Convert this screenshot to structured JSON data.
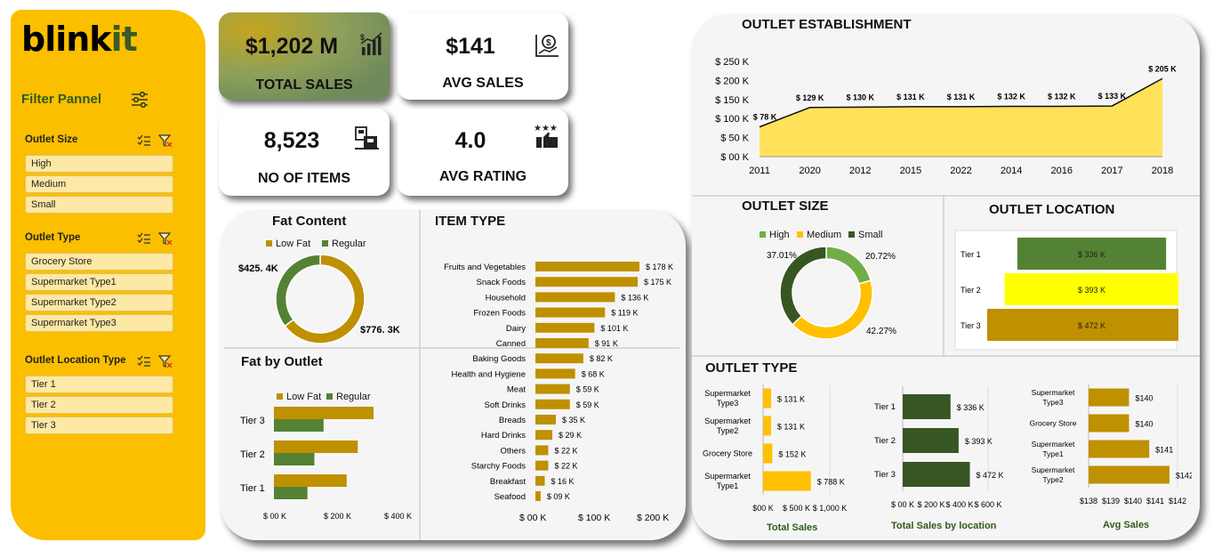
{
  "sidebar": {
    "logo_main": "blink",
    "logo_accent": "it",
    "filter_title": "Filter Pannel",
    "groups": [
      {
        "title": "Outlet Size",
        "items": [
          "High",
          "Medium",
          "Small"
        ]
      },
      {
        "title": "Outlet Type",
        "items": [
          "Grocery Store",
          "Supermarket Type1",
          "Supermarket Type2",
          "Supermarket Type3"
        ]
      },
      {
        "title": "Outlet Location Type",
        "items": [
          "Tier 1",
          "Tier 2",
          "Tier 3"
        ]
      }
    ]
  },
  "kpis": {
    "total_sales": {
      "value": "$1,202 M",
      "label": "TOTAL SALES",
      "icon": "bar-chart-money-icon"
    },
    "avg_sales": {
      "value": "$141",
      "label": "AVG SALES",
      "icon": "money-chart-icon"
    },
    "no_of_items": {
      "value": "8,523",
      "label": "NO OF ITEMS",
      "icon": "shopping-items-icon"
    },
    "avg_rating": {
      "value": "4.0",
      "label": "AVG RATING",
      "icon": "thumbs-up-stars-icon"
    }
  },
  "colors": {
    "gold": "#bf9000",
    "green": "#548235",
    "dark_green": "#375623",
    "yellow": "#ffff00",
    "bright_gold": "#ffc000",
    "area_fill": "#ffe699",
    "sidebar": "#fbbf00"
  },
  "chart_data": [
    {
      "id": "fat_content",
      "type": "pie",
      "title": "Fat Content",
      "legend": "top",
      "categories": [
        "Low Fat",
        "Regular"
      ],
      "values": [
        776.3,
        425.4
      ],
      "labels": [
        "$776. 3K",
        "$425. 4K"
      ]
    },
    {
      "id": "fat_by_outlet",
      "type": "bar",
      "title": "Fat by Outlet",
      "orientation": "horizontal",
      "legend": "top",
      "categories": [
        "Tier 3",
        "Tier 2",
        "Tier 1"
      ],
      "series": [
        {
          "name": "Low Fat",
          "values": [
            315,
            265,
            230
          ]
        },
        {
          "name": "Regular",
          "values": [
            157,
            128,
            106
          ]
        }
      ],
      "xticks": [
        "$ 00 K",
        "$ 200 K",
        "$ 400 K"
      ],
      "xlim": [
        0,
        450
      ]
    },
    {
      "id": "item_type",
      "type": "bar",
      "title": "ITEM TYPE",
      "orientation": "horizontal",
      "categories": [
        "Fruits and Vegetables",
        "Snack Foods",
        "Household",
        "Frozen Foods",
        "Dairy",
        "Canned",
        "Baking Goods",
        "Health and Hygiene",
        "Meat",
        "Soft Drinks",
        "Breads",
        "Hard Drinks",
        "Others",
        "Starchy Foods",
        "Breakfast",
        "Seafood"
      ],
      "values": [
        178,
        175,
        136,
        119,
        101,
        91,
        82,
        68,
        59,
        59,
        35,
        29,
        22,
        22,
        16,
        9
      ],
      "labels": [
        "$ 178 K",
        "$ 175 K",
        "$ 136 K",
        "$ 119 K",
        "$ 101 K",
        "$ 91 K",
        "$ 82 K",
        "$ 68 K",
        "$ 59 K",
        "$ 59 K",
        "$ 35 K",
        "$ 29 K",
        "$ 22 K",
        "$ 22 K",
        "$ 16 K",
        "$ 09 K"
      ],
      "xticks": [
        "$ 00 K",
        "$ 100 K",
        "$ 200 K"
      ],
      "xlim": [
        0,
        200
      ]
    },
    {
      "id": "outlet_establishment",
      "type": "area",
      "title": "OUTLET ESTABLISHMENT",
      "categories": [
        "2011",
        "2020",
        "2012",
        "2015",
        "2022",
        "2014",
        "2016",
        "2017",
        "2018"
      ],
      "values": [
        78,
        129,
        130,
        131,
        131,
        132,
        132,
        133,
        205
      ],
      "labels": [
        "$ 78 K",
        "$ 129 K",
        "$ 130 K",
        "$ 131 K",
        "$ 131 K",
        "$ 132 K",
        "$ 132 K",
        "$ 133 K",
        "$ 205 K"
      ],
      "yticks": [
        "$ 00 K",
        "$ 50 K",
        "$ 100 K",
        "$ 150 K",
        "$ 200 K",
        "$ 250 K"
      ],
      "ylim": [
        0,
        250
      ]
    },
    {
      "id": "outlet_size",
      "type": "pie",
      "title": "OUTLET SIZE",
      "legend": "top",
      "categories": [
        "High",
        "Medium",
        "Small"
      ],
      "values": [
        20.72,
        42.27,
        37.01
      ],
      "labels": [
        "20.72%",
        "42.27%",
        "37.01%"
      ]
    },
    {
      "id": "outlet_location",
      "type": "bar",
      "title": "OUTLET LOCATION",
      "orientation": "horizontal",
      "categories": [
        "Tier 1",
        "Tier 2",
        "Tier 3"
      ],
      "values": [
        336,
        393,
        472
      ],
      "labels": [
        "$ 336 K",
        "$ 393 K",
        "$ 472 K"
      ]
    },
    {
      "id": "total_sales_by_type",
      "type": "bar",
      "title": "OUTLET TYPE",
      "orientation": "horizontal",
      "xlabel": "Total Sales",
      "categories": [
        "Supermarket Type3",
        "Supermarket Type2",
        "Grocery Store",
        "Supermarket Type1"
      ],
      "values": [
        131,
        131,
        152,
        788
      ],
      "labels": [
        "$ 131 K",
        "$ 131 K",
        "$ 152 K",
        "$ 788 K"
      ],
      "xticks": [
        "$00 K",
        "$ 500 K",
        "$ 1,000 K"
      ],
      "xlim": [
        0,
        1100
      ]
    },
    {
      "id": "total_sales_by_location",
      "type": "bar",
      "orientation": "horizontal",
      "xlabel": "Total Sales by location",
      "categories": [
        "Tier 1",
        "Tier 2",
        "Tier 3"
      ],
      "values": [
        336,
        393,
        472
      ],
      "labels": [
        "$ 336 K",
        "$ 393 K",
        "$ 472 K"
      ],
      "xticks": [
        "$ 00 K",
        "$ 200 K",
        "$ 400 K",
        "$ 600 K"
      ],
      "xlim": [
        0,
        600
      ]
    },
    {
      "id": "avg_sales_by_type",
      "type": "bar",
      "orientation": "horizontal",
      "xlabel": "Avg Sales",
      "categories": [
        "Supermarket Type3",
        "Grocery Store",
        "Supermarket Type1",
        "Supermarket Type2"
      ],
      "values": [
        140,
        140,
        141,
        142
      ],
      "labels": [
        "$140",
        "$140",
        "$141",
        "$142"
      ],
      "xticks": [
        "$138",
        "$139",
        "$140",
        "$141",
        "$142"
      ],
      "xlim": [
        138,
        142.4
      ]
    }
  ]
}
